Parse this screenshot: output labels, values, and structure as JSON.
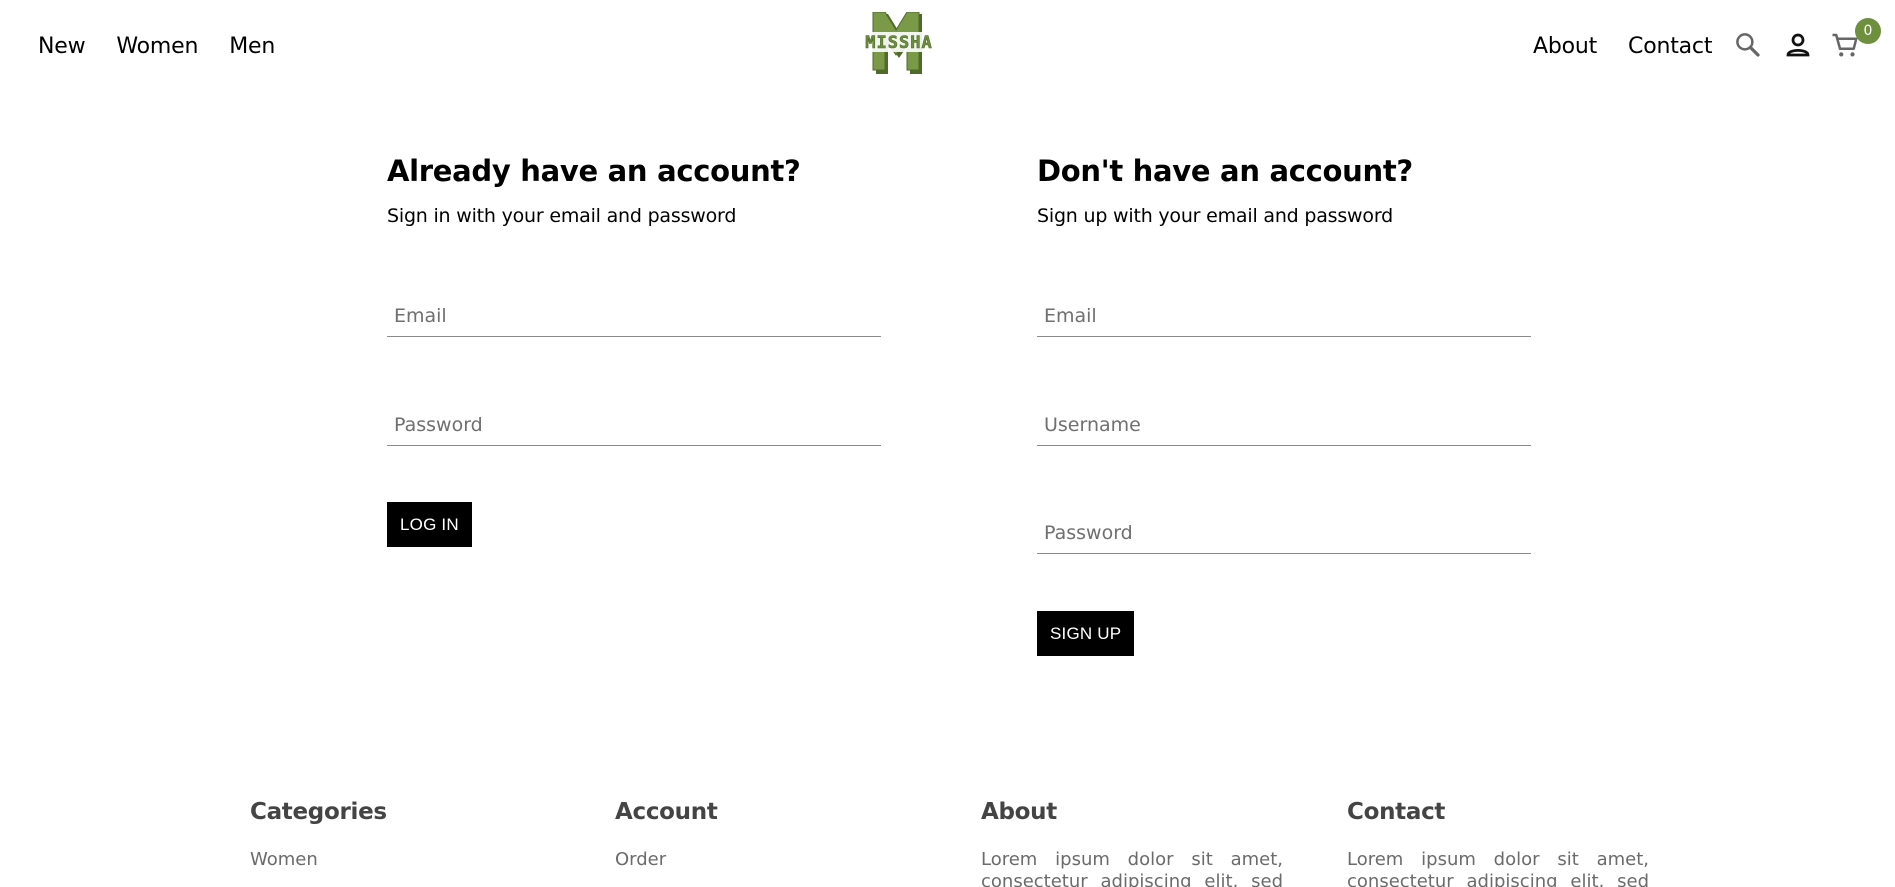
{
  "header": {
    "nav_left": [
      "New",
      "Women",
      "Men"
    ],
    "nav_right": [
      "About",
      "Contact"
    ],
    "logo_text": "MISSHA",
    "cart_count": "0",
    "brand_color": "#6d8f3e",
    "icons": [
      "search-icon",
      "person-icon",
      "cart-icon"
    ]
  },
  "login": {
    "title": "Already have an account?",
    "subtitle": "Sign in with your email and password",
    "email_placeholder": "Email",
    "password_placeholder": "Password",
    "button_label": "LOG IN"
  },
  "signup": {
    "title": "Don't have an account?",
    "subtitle": "Sign up with your email and password",
    "email_placeholder": "Email",
    "username_placeholder": "Username",
    "password_placeholder": "Password",
    "button_label": "SIGN UP"
  },
  "footer": {
    "categories": {
      "title": "Categories",
      "first_item": "Women"
    },
    "account": {
      "title": "Account",
      "first_item": "Order"
    },
    "about": {
      "title": "About",
      "text": "Lorem ipsum dolor sit amet, consectetur adipiscing elit, sed do"
    },
    "contact": {
      "title": "Contact",
      "text": "Lorem ipsum dolor sit amet, consectetur adipiscing elit, sed do"
    }
  }
}
